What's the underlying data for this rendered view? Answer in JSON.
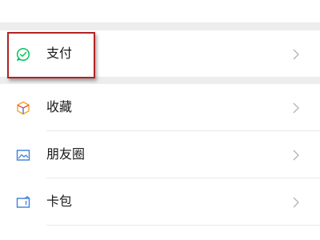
{
  "colors": {
    "background": "#ededed",
    "row_background": "#ffffff",
    "label_text": "#191919",
    "chevron": "#b2b2b2",
    "pay_icon": "#07c160",
    "favorites_icon": "#f5a623",
    "moments_icon": "#3c7fd9",
    "cards_icon": "#3c7fd9",
    "highlight_border": "#b22222"
  },
  "menu": {
    "pay": {
      "label": "支付",
      "icon": "pay-icon"
    },
    "favorites": {
      "label": "收藏",
      "icon": "cube-icon"
    },
    "moments": {
      "label": "朋友圈",
      "icon": "picture-icon"
    },
    "cards": {
      "label": "卡包",
      "icon": "wallet-icon"
    }
  }
}
